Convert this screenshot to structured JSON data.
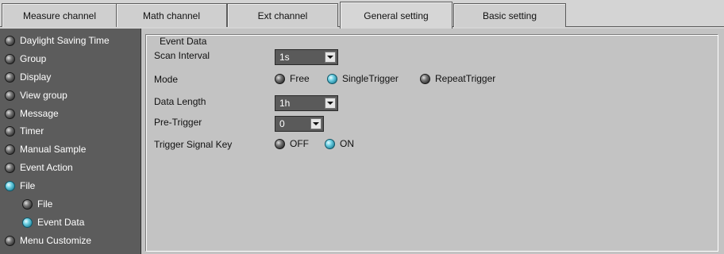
{
  "tabs": [
    {
      "label": "Measure channel",
      "active": false
    },
    {
      "label": "Math channel",
      "active": false
    },
    {
      "label": "Ext channel",
      "active": false
    },
    {
      "label": "General setting",
      "active": true
    },
    {
      "label": "Basic setting",
      "active": false
    }
  ],
  "sidebar": {
    "items": [
      {
        "label": "Daylight Saving Time",
        "selected": false
      },
      {
        "label": "Group",
        "selected": false
      },
      {
        "label": "Display",
        "selected": false
      },
      {
        "label": "View group",
        "selected": false
      },
      {
        "label": "Message",
        "selected": false
      },
      {
        "label": "Timer",
        "selected": false
      },
      {
        "label": "Manual Sample",
        "selected": false
      },
      {
        "label": "Event Action",
        "selected": false
      },
      {
        "label": "File",
        "selected": true
      },
      {
        "label": "File",
        "selected": false
      },
      {
        "label": "Event Data",
        "selected": true
      },
      {
        "label": "Menu Customize",
        "selected": false
      }
    ]
  },
  "event_data": {
    "legend": "Event Data",
    "scan_interval": {
      "label": "Scan Interval",
      "value": "1s"
    },
    "mode": {
      "label": "Mode",
      "options": [
        "Free",
        "SingleTrigger",
        "RepeatTrigger"
      ],
      "selected": "SingleTrigger"
    },
    "data_length": {
      "label": "Data Length",
      "value": "1h"
    },
    "pre_trigger": {
      "label": "Pre-Trigger",
      "value": "0"
    },
    "trigger_signal_key": {
      "label": "Trigger Signal Key",
      "options": [
        "OFF",
        "ON"
      ],
      "selected": "ON"
    }
  },
  "colors": {
    "sidebar_bg": "#5c5c5c",
    "panel_bg": "#c3c3c3",
    "radio_on": "#3fb3cc",
    "radio_off": "#3a3a3a"
  }
}
